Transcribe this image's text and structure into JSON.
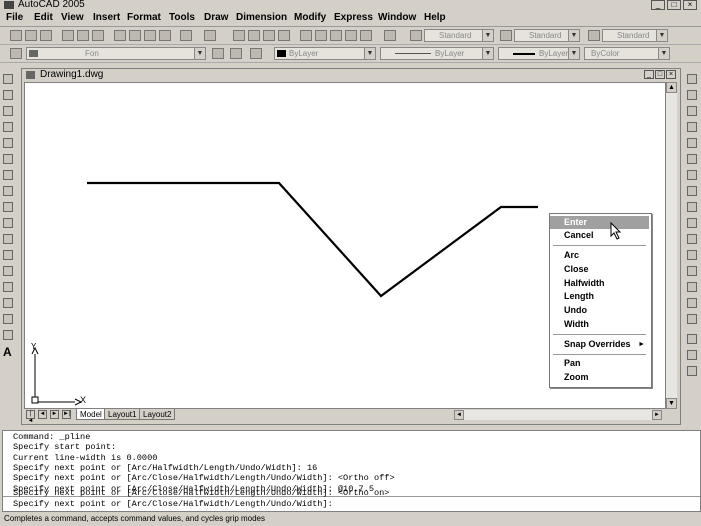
{
  "app": {
    "title": "AutoCAD 2005"
  },
  "menu": [
    "File",
    "Edit",
    "View",
    "Insert",
    "Format",
    "Tools",
    "Draw",
    "Dimension",
    "Modify",
    "Express",
    "Window",
    "Help"
  ],
  "toolbar": {
    "layer_value": "Fon",
    "color_value": "ByLayer",
    "linetype_value": "ByLayer",
    "lineweight_value": "ByLayer",
    "plotstyle_value": "ByColor",
    "text_style": "Standard",
    "dim_style": "Standard",
    "table_style": "Standard"
  },
  "drawing": {
    "title": "Drawing1.dwg",
    "tabs": [
      "Model",
      "Layout1",
      "Layout2"
    ],
    "active_tab": "Model",
    "ucs_y": "Y",
    "ucs_x": "X"
  },
  "context_menu": {
    "items": [
      "Enter",
      "Cancel",
      "Arc",
      "Close",
      "Halfwidth",
      "Length",
      "Undo",
      "Width",
      "Snap Overrides",
      "Pan",
      "Zoom"
    ],
    "highlighted": "Enter"
  },
  "command_window": {
    "lines": [
      "Command: _pline",
      "Specify start point:",
      "Current line-width is 0.0000",
      "Specify next point or [Arc/Halfwidth/Length/Undo/Width]: 16",
      "Specify next point or [Arc/Close/Halfwidth/Length/Undo/Width]: <Ortho off>",
      "Specify next point or [Arc/Close/Halfwidth/Length/Undo/Width]: @10.7.5",
      "Specify next point or [Arc/Close/Halfwidth/Length/Undo/Width]: <Ortho on>",
      "Specify next point or [Arc/Close/Halfwidth/Length/Undo/Width]:"
    ]
  },
  "status": {
    "text": "Completes a command, accepts command values, and cycles grip modes"
  },
  "colors": {
    "background": "#d4d0c8",
    "canvas": "#ffffff",
    "highlight": "#a0a0a0",
    "polyline": "#000000"
  }
}
